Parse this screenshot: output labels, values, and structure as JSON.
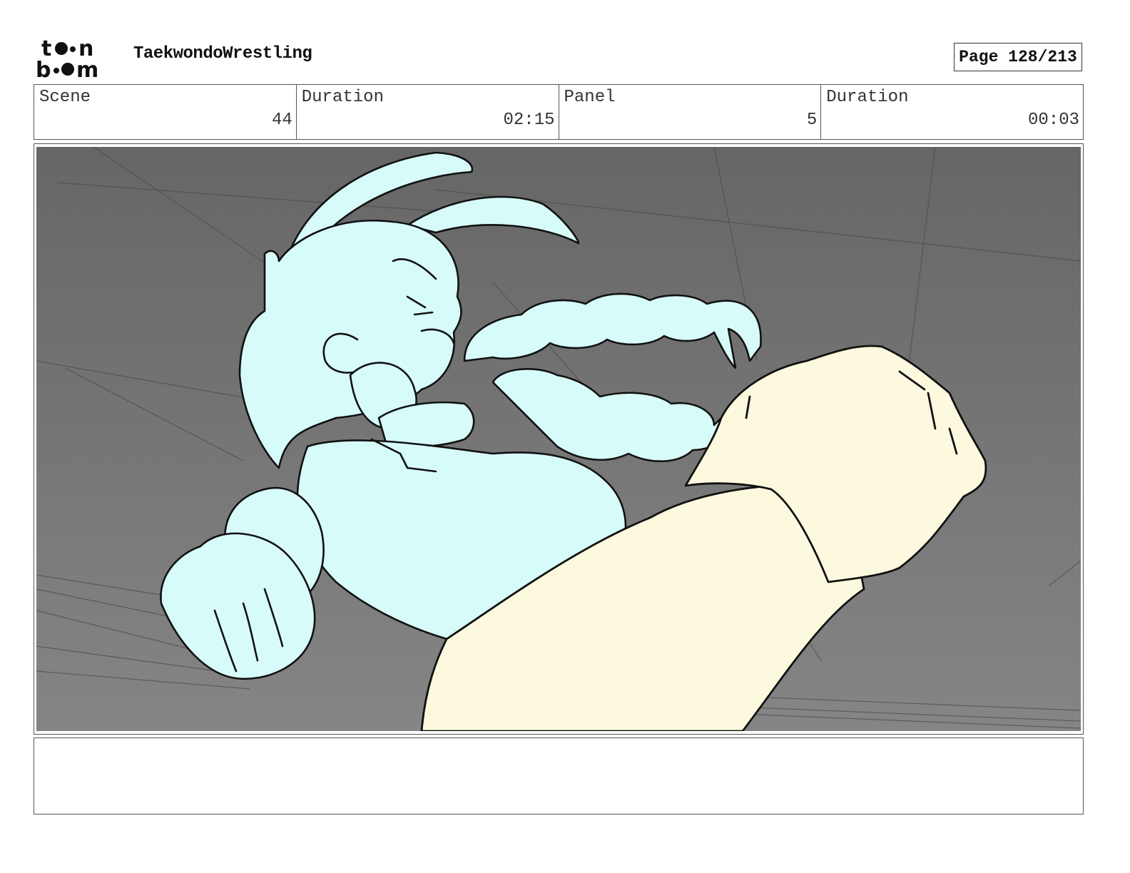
{
  "header": {
    "logo_alt": "toon boom",
    "project_title": "TaekwondoWrestling",
    "page_label": "Page 128/213"
  },
  "info": {
    "scene_label": "Scene",
    "scene_value": "44",
    "scene_duration_label": "Duration",
    "scene_duration_value": "02:15",
    "panel_label": "Panel",
    "panel_value": "5",
    "panel_duration_label": "Duration",
    "panel_duration_value": "00:03"
  },
  "panel": {
    "background_color": "#7a7a7a",
    "character_color": "#d6fbf8",
    "fist_color": "#fdf9df"
  },
  "notes": {
    "text": ""
  }
}
